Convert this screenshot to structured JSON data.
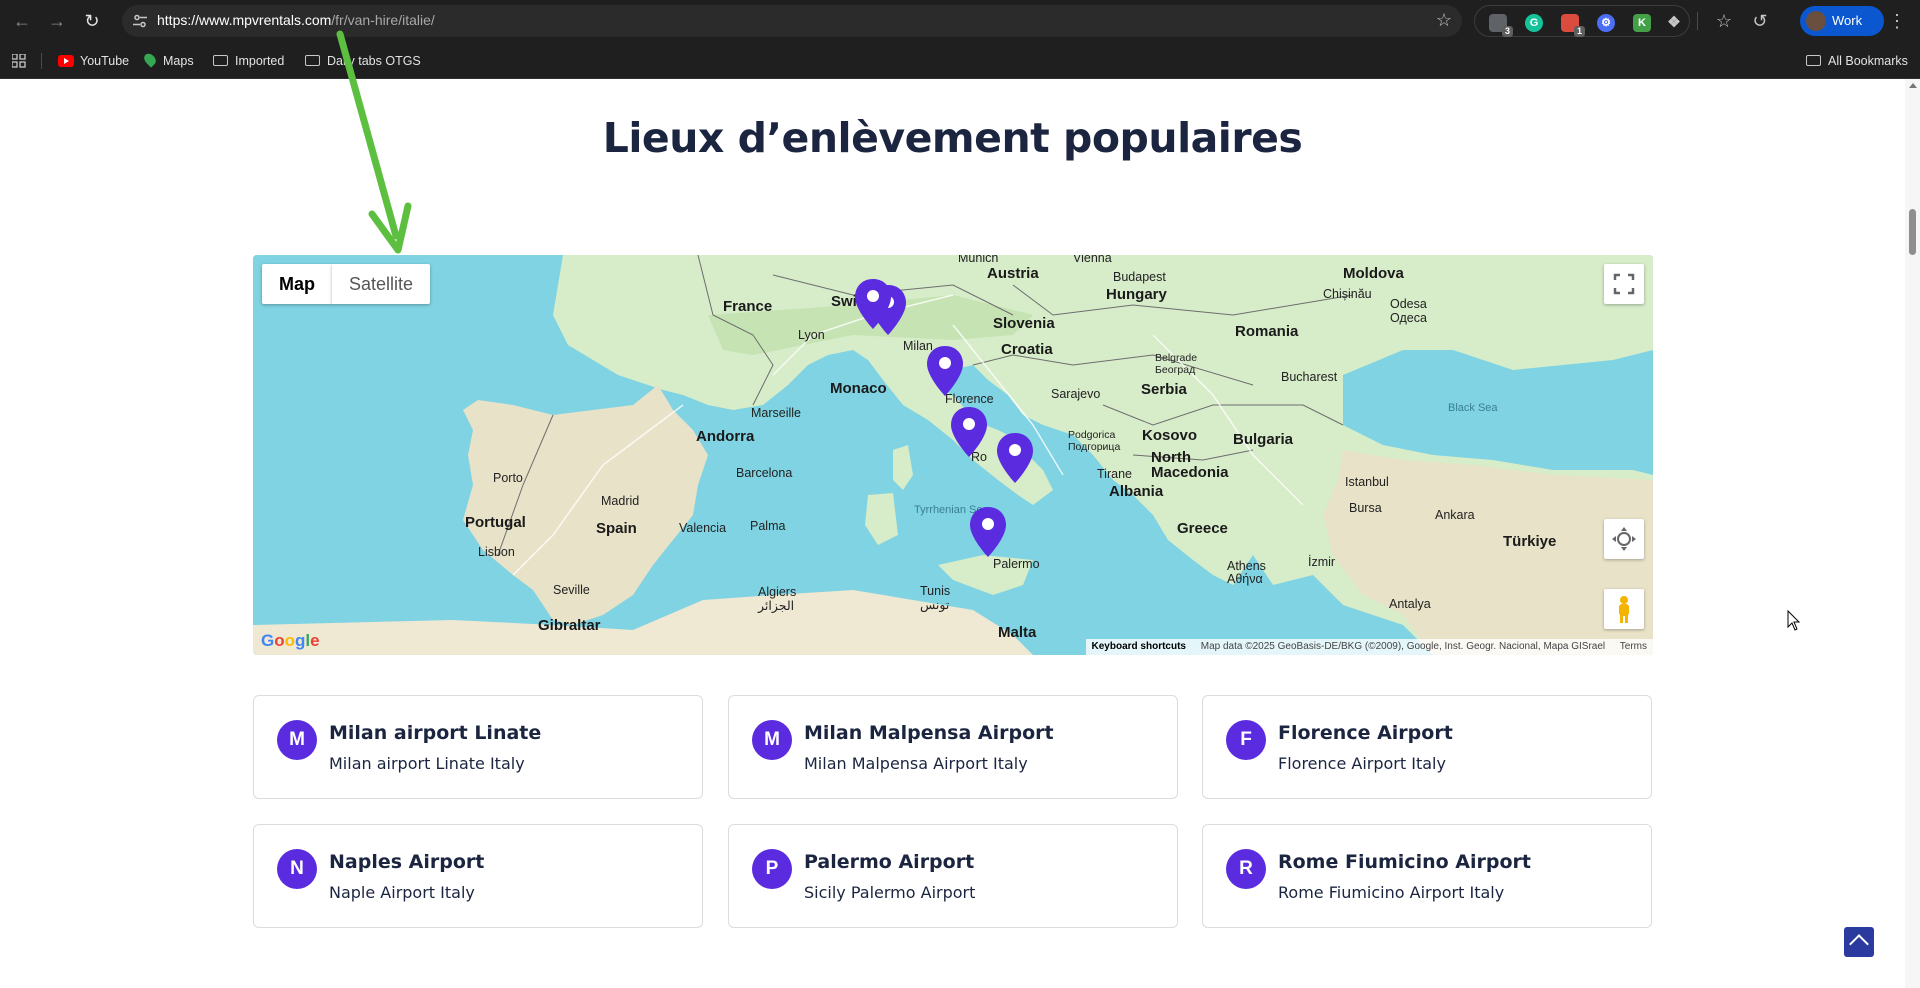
{
  "browser": {
    "url_host": "https://www.mpvrentals.com",
    "url_path": "/fr/van-hire/italie/",
    "profile_name": "Work",
    "extensions": [
      {
        "name": "tab-manager-extension",
        "badge": "3",
        "color": "#5f6368"
      },
      {
        "name": "grammarly-extension",
        "badge": "",
        "color": "#15c39a"
      },
      {
        "name": "todoist-extension",
        "badge": "1",
        "color": "#db4c3f"
      },
      {
        "name": "settings-extension",
        "badge": "",
        "color": "#4c6ef5"
      },
      {
        "name": "keepa-extension",
        "badge": "",
        "color": "#43a047"
      }
    ]
  },
  "bookmarks": {
    "items": [
      {
        "label": "YouTube",
        "icon": "youtube-icon"
      },
      {
        "label": "Maps",
        "icon": "maps-icon"
      },
      {
        "label": "Imported",
        "icon": "folder-icon"
      },
      {
        "label": "Daily tabs OTGS",
        "icon": "folder-icon"
      }
    ],
    "all_label": "All Bookmarks"
  },
  "page": {
    "heading": "Lieux d’enlèvement populaires"
  },
  "map": {
    "type_map": "Map",
    "type_satellite": "Satellite",
    "google": "Google",
    "keyboard_shortcuts": "Keyboard shortcuts",
    "map_data": "Map data ©2025 GeoBasis-DE/BKG (©2009), Google, Inst. Geogr. Nacional, Mapa GISrael",
    "terms": "Terms",
    "labels": {
      "munich": "Munich",
      "vienna": "Vienna",
      "budapest": "Budapest",
      "moldova": "Moldova",
      "austria": "Austria",
      "hungary": "Hungary",
      "chisinau": "Chișinău",
      "odesa": "Odesa\nОдеса",
      "france": "France",
      "switz": "Switz",
      "lyon": "Lyon",
      "milan": "Milan",
      "slovenia": "Slovenia",
      "romania": "Romania",
      "croatia": "Croatia",
      "belgrade": "Belgrade\nБеоград",
      "monaco": "Monaco",
      "florence": "Florence",
      "sarajevo": "Sarajevo",
      "serbia": "Serbia",
      "bucharest": "Bucharest",
      "marseille": "Marseille",
      "black_sea": "Black Sea",
      "andorra": "Andorra",
      "podgorica": "Podgorica\nПодгорица",
      "kosovo": "Kosovo",
      "bulgaria": "Bulgaria",
      "rome": "Ro",
      "north_macedonia": "North\nMacedonia",
      "porto": "Porto",
      "barcelona": "Barcelona",
      "tirane": "Tirane",
      "albania": "Albania",
      "istanbul": "Istanbul",
      "madrid": "Madrid",
      "tyrrhenian": "Tyrrhenian Sea",
      "bursa": "Bursa",
      "ankara": "Ankara",
      "portugal": "Portugal",
      "spain": "Spain",
      "valencia": "Valencia",
      "palma": "Palma",
      "greece": "Greece",
      "turkiye": "Türkiye",
      "lisbon": "Lisbon",
      "palermo": "Palermo",
      "athens": "Athens\nΑθήνα",
      "izmir": "İzmir",
      "seville": "Seville",
      "algiers": "Algiers\nالجزائر",
      "tunis": "Tunis\nتونس",
      "antalya": "Antalya",
      "gibraltar": "Gibraltar",
      "malta": "Malta"
    }
  },
  "locations": [
    {
      "initial": "M",
      "title": "Milan airport Linate",
      "subtitle": "Milan airport Linate Italy"
    },
    {
      "initial": "M",
      "title": "Milan Malpensa Airport",
      "subtitle": "Milan Malpensa Airport Italy"
    },
    {
      "initial": "F",
      "title": "Florence Airport",
      "subtitle": "Florence Airport Italy"
    },
    {
      "initial": "N",
      "title": "Naples Airport",
      "subtitle": "Naple Airport Italy"
    },
    {
      "initial": "P",
      "title": "Palermo Airport",
      "subtitle": "Sicily Palermo Airport"
    },
    {
      "initial": "R",
      "title": "Rome Fiumicino Airport",
      "subtitle": "Rome Fiumicino Airport Italy"
    }
  ],
  "colors": {
    "accent": "#5b2be0",
    "heading": "#1b2540",
    "annotation_arrow": "#5cbf3f"
  }
}
